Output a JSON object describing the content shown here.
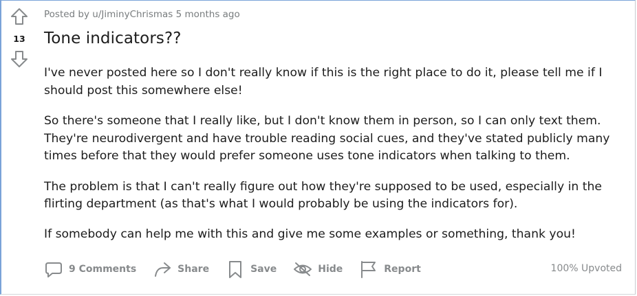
{
  "post": {
    "score": "13",
    "meta_prefix": "Posted by",
    "author": "u/JiminyChrismas",
    "time": "5 months ago",
    "title": "Tone indicators??",
    "paragraphs": [
      "I've never posted here so I don't really know if this is the right place to do it, please tell me if I should post this somewhere else!",
      "So there's someone that I really like, but I don't know them in person, so I can only text them. They're neurodivergent and have trouble reading social cues, and they've stated publicly many times before that they would prefer someone uses tone indicators when talking to them.",
      "The problem is that I can't really figure out how they're supposed to be used, especially in the flirting department (as that's what I would probably be using the indicators for).",
      "If somebody can help me with this and give me some examples or something, thank you!"
    ]
  },
  "actions": {
    "comments_label": "9 Comments",
    "share_label": "Share",
    "save_label": "Save",
    "hide_label": "Hide",
    "report_label": "Report",
    "upvoted_text": "100% Upvoted"
  },
  "icons": {
    "upvote": "arrow-up-icon",
    "downvote": "arrow-down-icon",
    "comments": "speech-bubble-icon",
    "share": "share-arrow-icon",
    "save": "bookmark-icon",
    "hide": "eye-slash-icon",
    "report": "flag-icon"
  },
  "colors": {
    "icon_gray": "#878a8c",
    "text": "#1c1c1c",
    "meta": "#787c7e",
    "border_accent": "#7aa3d8"
  }
}
